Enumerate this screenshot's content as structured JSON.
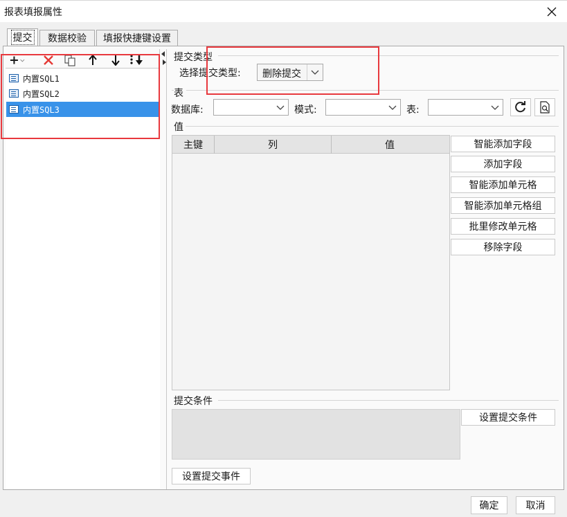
{
  "window": {
    "title": "报表填报属性"
  },
  "tabs": [
    {
      "label": "提交",
      "active": true
    },
    {
      "label": "数据校验",
      "active": false
    },
    {
      "label": "填报快捷键设置",
      "active": false
    }
  ],
  "toolbar": {
    "icons": [
      "add-icon",
      "delete-icon",
      "copy-icon",
      "move-up-icon",
      "move-down-icon",
      "move-bottom-icon"
    ],
    "colors": {
      "add": "#1a1a1a",
      "delete": "#e53935"
    }
  },
  "sql_list": [
    {
      "name": "内置SQL1",
      "selected": false
    },
    {
      "name": "内置SQL2",
      "selected": false
    },
    {
      "name": "内置SQL3",
      "selected": true
    }
  ],
  "submit_type": {
    "group_label": "提交类型",
    "field_label": "选择提交类型:",
    "value": "删除提交"
  },
  "table_section": {
    "group_label": "表",
    "database_label": "数据库:",
    "database_value": "",
    "mode_label": "模式:",
    "mode_value": "",
    "table_label": "表:",
    "table_value": ""
  },
  "value_section": {
    "group_label": "值",
    "columns": [
      "主键",
      "列",
      "值"
    ],
    "rows": [],
    "buttons": [
      "智能添加字段",
      "添加字段",
      "智能添加单元格",
      "智能添加单元格组",
      "批里修改单元格",
      "移除字段"
    ]
  },
  "condition_section": {
    "group_label": "提交条件",
    "set_button": "设置提交条件"
  },
  "event_button": "设置提交事件",
  "footer": {
    "ok": "确定",
    "cancel": "取消"
  },
  "accent": {
    "selection": "#3892e9",
    "highlight": "#e8383d"
  }
}
